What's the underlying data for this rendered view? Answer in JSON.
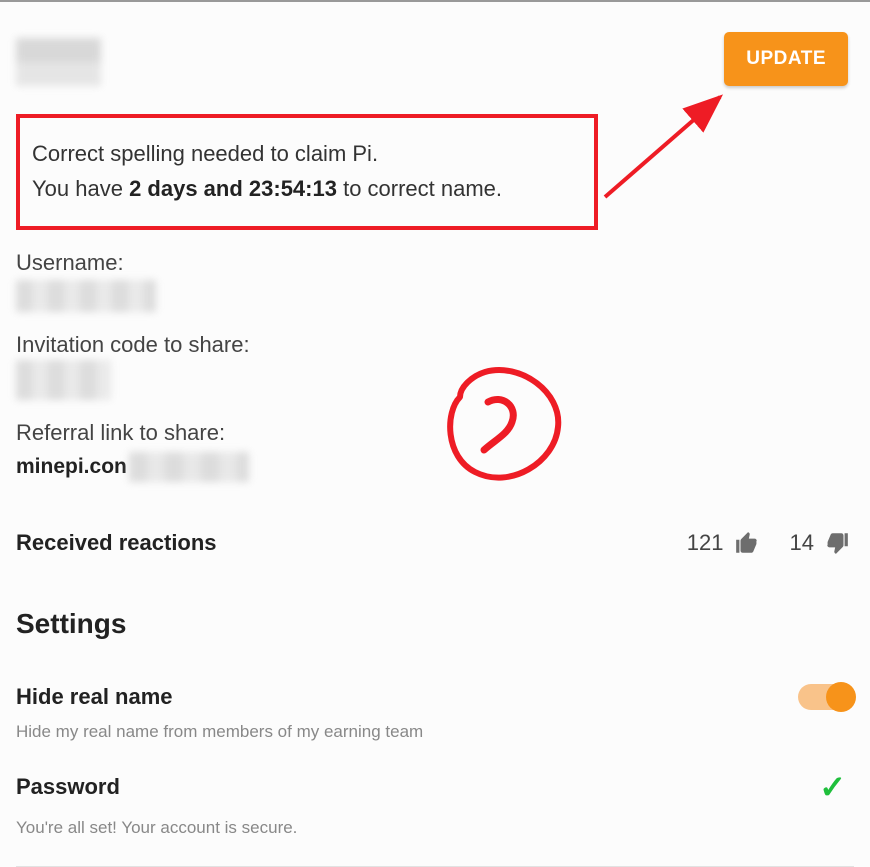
{
  "update_button": "UPDATE",
  "warning": {
    "line1": "Correct spelling needed to claim Pi.",
    "line2_pre": "You have ",
    "countdown": "2 days and 23:54:13",
    "line2_post": " to correct name."
  },
  "username_label": "Username:",
  "invite_label": "Invitation code to share:",
  "referral_label": "Referral link to share:",
  "referral_link": "minepi.con",
  "reactions": {
    "label": "Received reactions",
    "up_count": "121",
    "down_count": "14"
  },
  "settings_heading": "Settings",
  "hide_name": {
    "title": "Hide real name",
    "desc": "Hide my real name from members of my earning team",
    "enabled": true
  },
  "password": {
    "title": "Password",
    "desc": "You're all set! Your account is secure.",
    "ok": true
  },
  "annotation_number": "2"
}
